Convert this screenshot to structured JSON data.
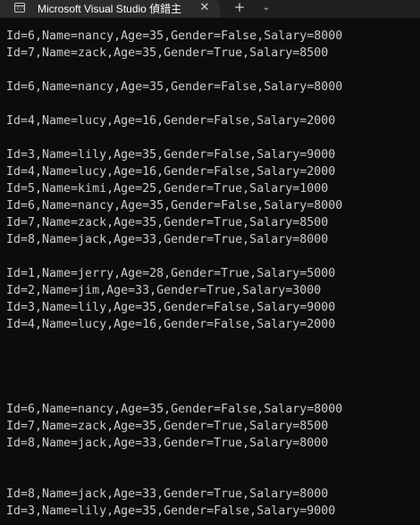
{
  "window": {
    "tab_title": "Microsoft Visual Studio 偵錯主",
    "tab_icon_glyph": "C:\\"
  },
  "console": {
    "lines": [
      "Id=6,Name=nancy,Age=35,Gender=False,Salary=8000",
      "Id=7,Name=zack,Age=35,Gender=True,Salary=8500",
      "",
      "Id=6,Name=nancy,Age=35,Gender=False,Salary=8000",
      "",
      "Id=4,Name=lucy,Age=16,Gender=False,Salary=2000",
      "",
      "Id=3,Name=lily,Age=35,Gender=False,Salary=9000",
      "Id=4,Name=lucy,Age=16,Gender=False,Salary=2000",
      "Id=5,Name=kimi,Age=25,Gender=True,Salary=1000",
      "Id=6,Name=nancy,Age=35,Gender=False,Salary=8000",
      "Id=7,Name=zack,Age=35,Gender=True,Salary=8500",
      "Id=8,Name=jack,Age=33,Gender=True,Salary=8000",
      "",
      "Id=1,Name=jerry,Age=28,Gender=True,Salary=5000",
      "Id=2,Name=jim,Age=33,Gender=True,Salary=3000",
      "Id=3,Name=lily,Age=35,Gender=False,Salary=9000",
      "Id=4,Name=lucy,Age=16,Gender=False,Salary=2000",
      "",
      "",
      "",
      "",
      "Id=6,Name=nancy,Age=35,Gender=False,Salary=8000",
      "Id=7,Name=zack,Age=35,Gender=True,Salary=8500",
      "Id=8,Name=jack,Age=33,Gender=True,Salary=8000",
      "",
      "",
      "Id=8,Name=jack,Age=33,Gender=True,Salary=8000",
      "Id=3,Name=lily,Age=35,Gender=False,Salary=9000"
    ]
  }
}
